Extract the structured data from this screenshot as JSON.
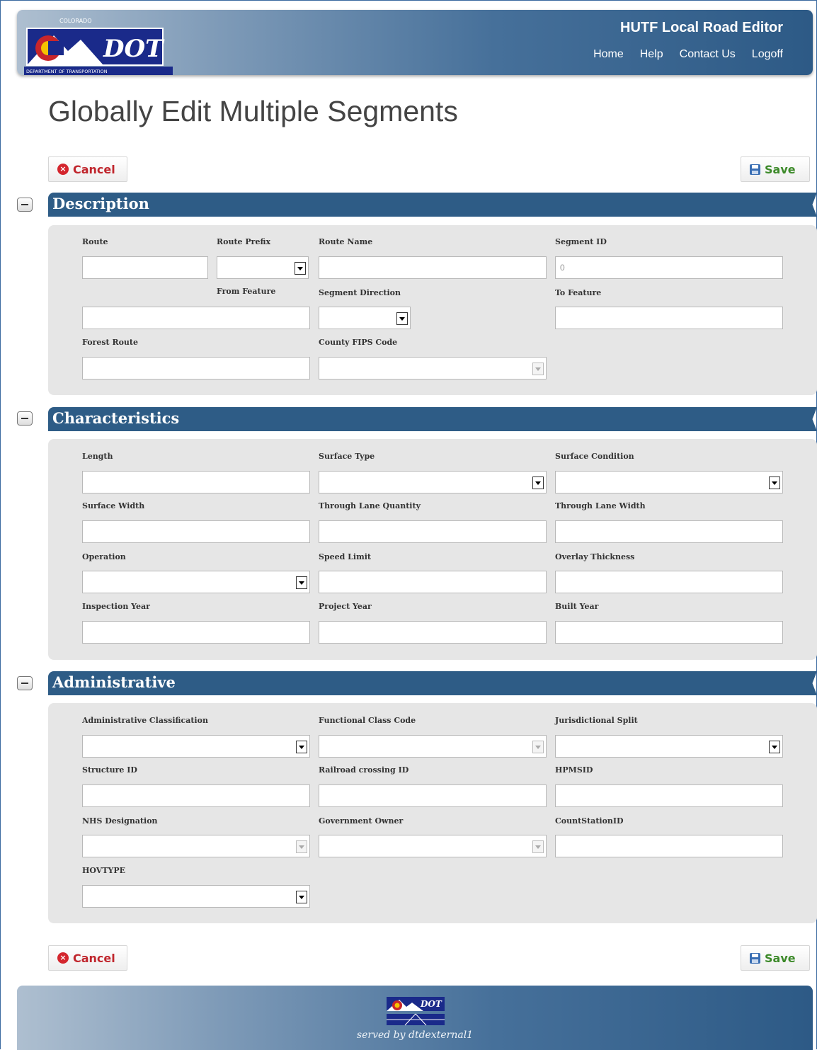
{
  "header": {
    "logo_text": {
      "top": "COLORADO",
      "main": "DOT",
      "bottom": "DEPARTMENT OF TRANSPORTATION"
    },
    "app_title": "HUTF Local Road Editor",
    "nav": [
      "Home",
      "Help",
      "Contact Us",
      "Logoff"
    ]
  },
  "page_title": "Globally Edit Multiple Segments",
  "buttons": {
    "cancel": "Cancel",
    "save": "Save"
  },
  "sections": {
    "description": {
      "title": "Description",
      "labels": {
        "route": "Route",
        "route_prefix": "Route Prefix",
        "route_name": "Route Name",
        "segment_id": "Segment ID",
        "from_feature": "From Feature",
        "segment_direction": "Segment Direction",
        "to_feature": "To Feature",
        "forest_route": "Forest Route",
        "county_fips": "County FIPS Code"
      },
      "values": {
        "segment_id": "0"
      }
    },
    "characteristics": {
      "title": "Characteristics",
      "labels": {
        "length": "Length",
        "surface_type": "Surface Type",
        "surface_condition": "Surface Condition",
        "surface_width": "Surface Width",
        "through_lane_quantity": "Through Lane Quantity",
        "through_lane_width": "Through Lane Width",
        "operation": "Operation",
        "speed_limit": "Speed Limit",
        "overlay_thickness": "Overlay Thickness",
        "inspection_year": "Inspection Year",
        "project_year": "Project Year",
        "built_year": "Built Year"
      }
    },
    "administrative": {
      "title": "Administrative",
      "labels": {
        "admin_class": "Administrative Classification",
        "functional_class": "Functional Class Code",
        "juris_split": "Jurisdictional Split",
        "structure_id": "Structure ID",
        "railroad_id": "Railroad crossing ID",
        "hpmsid": "HPMSID",
        "nhs": "NHS Designation",
        "gov_owner": "Government Owner",
        "countstation": "CountStationID",
        "hovtype": "HOVTYPE"
      }
    }
  },
  "footer": {
    "served_by": "served by dtdexternal1",
    "logo_text": "DOT"
  },
  "colors": {
    "header_dark": "#2d5a86",
    "section_bar": "#2e5c86",
    "panel": "#e6e6e6",
    "cancel": "#c0262d",
    "save": "#3d8a2a"
  }
}
